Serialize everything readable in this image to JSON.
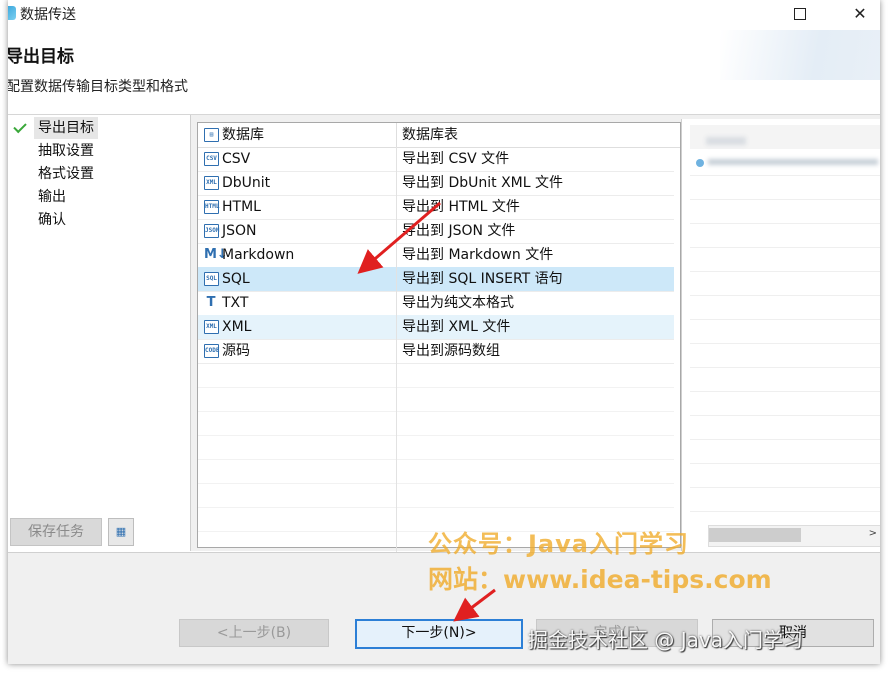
{
  "window": {
    "title": "数据传送",
    "maximize_glyph": "□",
    "close_glyph": "✕"
  },
  "header": {
    "title": "导出目标",
    "subtitle": "配置数据传输目标类型和格式"
  },
  "nav": {
    "items": [
      {
        "label": "导出目标",
        "active": true
      },
      {
        "label": "抽取设置"
      },
      {
        "label": "格式设置"
      },
      {
        "label": "输出"
      },
      {
        "label": "确认"
      }
    ],
    "save_task_label": "保存任务"
  },
  "table": {
    "columns": [
      "数据库",
      "数据库表"
    ],
    "rows": [
      {
        "icon": "csv-icon",
        "icon_text": "CSV",
        "name": "CSV",
        "desc": "导出到 CSV 文件"
      },
      {
        "icon": "xml-icon",
        "icon_text": "XML",
        "name": "DbUnit",
        "desc": "导出到 DbUnit XML 文件"
      },
      {
        "icon": "html-icon",
        "icon_text": "HTML",
        "name": "HTML",
        "desc": "导出到 HTML 文件"
      },
      {
        "icon": "json-icon",
        "icon_text": "JSON",
        "name": "JSON",
        "desc": "导出到 JSON 文件"
      },
      {
        "icon": "markdown-icon",
        "icon_text": "M↓",
        "name": "Markdown",
        "desc": "导出到 Markdown 文件"
      },
      {
        "icon": "sql-icon",
        "icon_text": "SQL",
        "name": "SQL",
        "desc": "导出到 SQL INSERT 语句",
        "selected": true
      },
      {
        "icon": "txt-icon",
        "icon_text": "T",
        "name": "TXT",
        "desc": "导出为纯文本格式"
      },
      {
        "icon": "xml-icon",
        "icon_text": "XML",
        "name": "XML",
        "desc": "导出到 XML 文件",
        "alt": true
      },
      {
        "icon": "code-icon",
        "icon_text": "CODE",
        "name": "源码",
        "desc": "导出到源码数组"
      }
    ]
  },
  "buttons": {
    "prev": "<上一步(B)",
    "next": "下一步(N)>",
    "finish": "完成(F)",
    "cancel": "取消"
  },
  "watermarks": {
    "line1": "公众号：Java入门学习",
    "line2": "网站：www.idea-tips.com",
    "line3": "掘金技术社区 @ Java入门学习"
  },
  "colors": {
    "selected_row": "#cde8f9",
    "primary_border": "#2c7fd6",
    "arrow": "#e02020",
    "watermark": "#f0aa28"
  }
}
